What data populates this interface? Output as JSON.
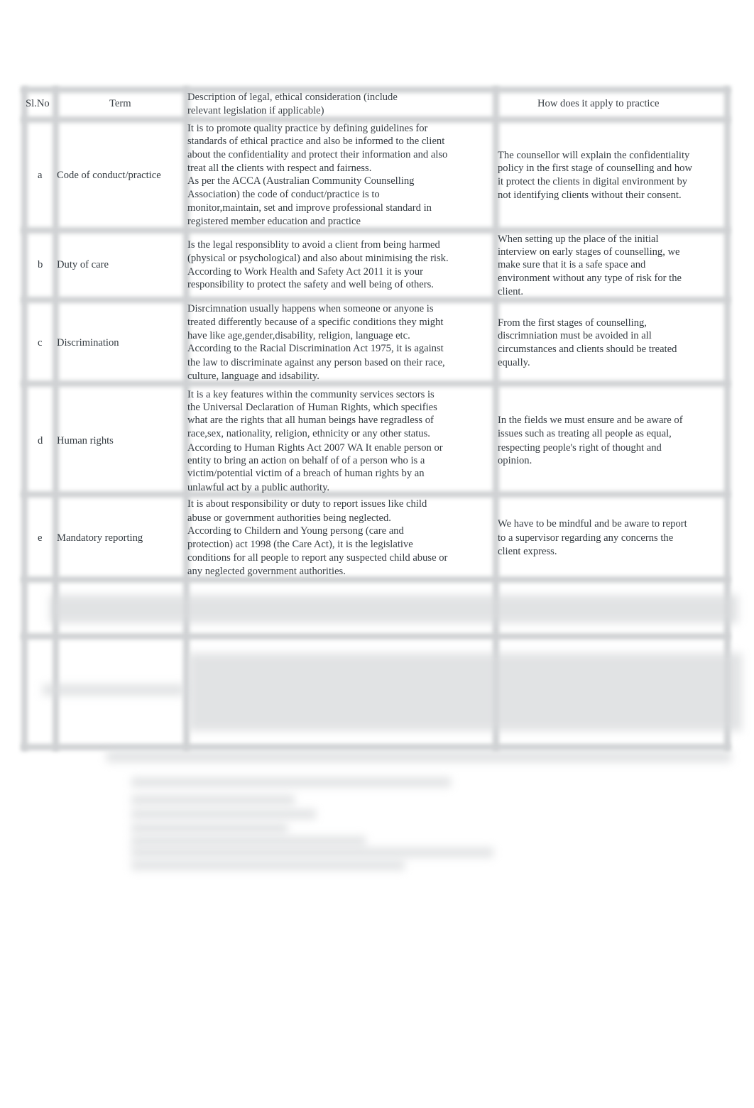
{
  "table": {
    "headers": {
      "sl_no": "Sl.No",
      "term": "Term",
      "description_line1": "Description of legal, ethical consideration (include",
      "description_line2": "relevant legislation if applicable)",
      "application": "How does it apply to practice"
    },
    "rows": [
      {
        "sl": "a",
        "term": "Code of conduct/practice",
        "description": [
          "It is to promote quality practice by defining guidelines for",
          "standards of ethical practice and also be informed to the client",
          "about the confidentiality and protect their information and also",
          "treat all the clients with respect and fairness.",
          "As per the ACCA (Australian Community Counselling",
          "Association) the code of conduct/practice is to",
          "monitor,maintain, set and improve professional standard in",
          "registered member education and practice"
        ],
        "application": [
          "The counsellor will explain the confidentiality",
          "policy in the first stage of counselling and how",
          "it protect the clients in digital environment by",
          "not identifying clients without their consent."
        ]
      },
      {
        "sl": "b",
        "term": "Duty of care",
        "description": [
          "Is the legal responsiblity to avoid a client from being harmed",
          "(physical or psychological) and also about minimising the risk.",
          "According to Work Health and Safety Act 2011 it is your",
          "responsibility to protect the safety and well being of others."
        ],
        "application": [
          "When setting up the place of the initial",
          "interview on early stages of counselling, we",
          "make sure that it is a safe space and",
          "environment without any type of risk for the",
          "client."
        ]
      },
      {
        "sl": "c",
        "term": "Discrimination",
        "description": [
          "Disrcimnation usually happens when someone or anyone is",
          "treated differently because of a specific conditions they might",
          "have like age,gender,disability, religion, language etc.",
          "According to the Racial Discrimination Act 1975, it is against",
          "the law to discriminate against any person based on their race,",
          "culture, language and idsability."
        ],
        "application": [
          "From the first stages of counselling,",
          "discrimniation must be avoided in all",
          "circumstances and clients should be treated",
          "equally."
        ]
      },
      {
        "sl": "d",
        "term": "Human rights",
        "description": [
          "It is a key features within the community services sectors is",
          "the Universal Declaration of Human Rights, which specifies",
          "what are the rights that all human beings have regradless of",
          "race,sex, nationality, religion, ethnicity or any other status.",
          "According to Human Rights Act 2007 WA It enable person or",
          "entity to bring an action on behalf of of a person who is a",
          "victim/potential victim of a breach of human rights by an",
          "unlawful act by a public authority."
        ],
        "application": [
          "In the fields we must ensure and be aware of",
          "issues such as treating all people as equal,",
          "respecting people's right of thought and",
          "opinion."
        ]
      },
      {
        "sl": "e",
        "term": "Mandatory reporting",
        "description": [
          "It is about responsibility or duty to report issues like child",
          "abuse or government authorities being neglected.",
          "According to Childern and Young persong (care and",
          "protection) act 1998 (the Care Act), it is the legislative",
          "conditions for all people to report any suspected child abuse or",
          "any neglected government authorities."
        ],
        "application": [
          "We have to be mindful and be aware to report",
          "to a supervisor regarding any concerns the",
          "client express."
        ]
      }
    ]
  }
}
